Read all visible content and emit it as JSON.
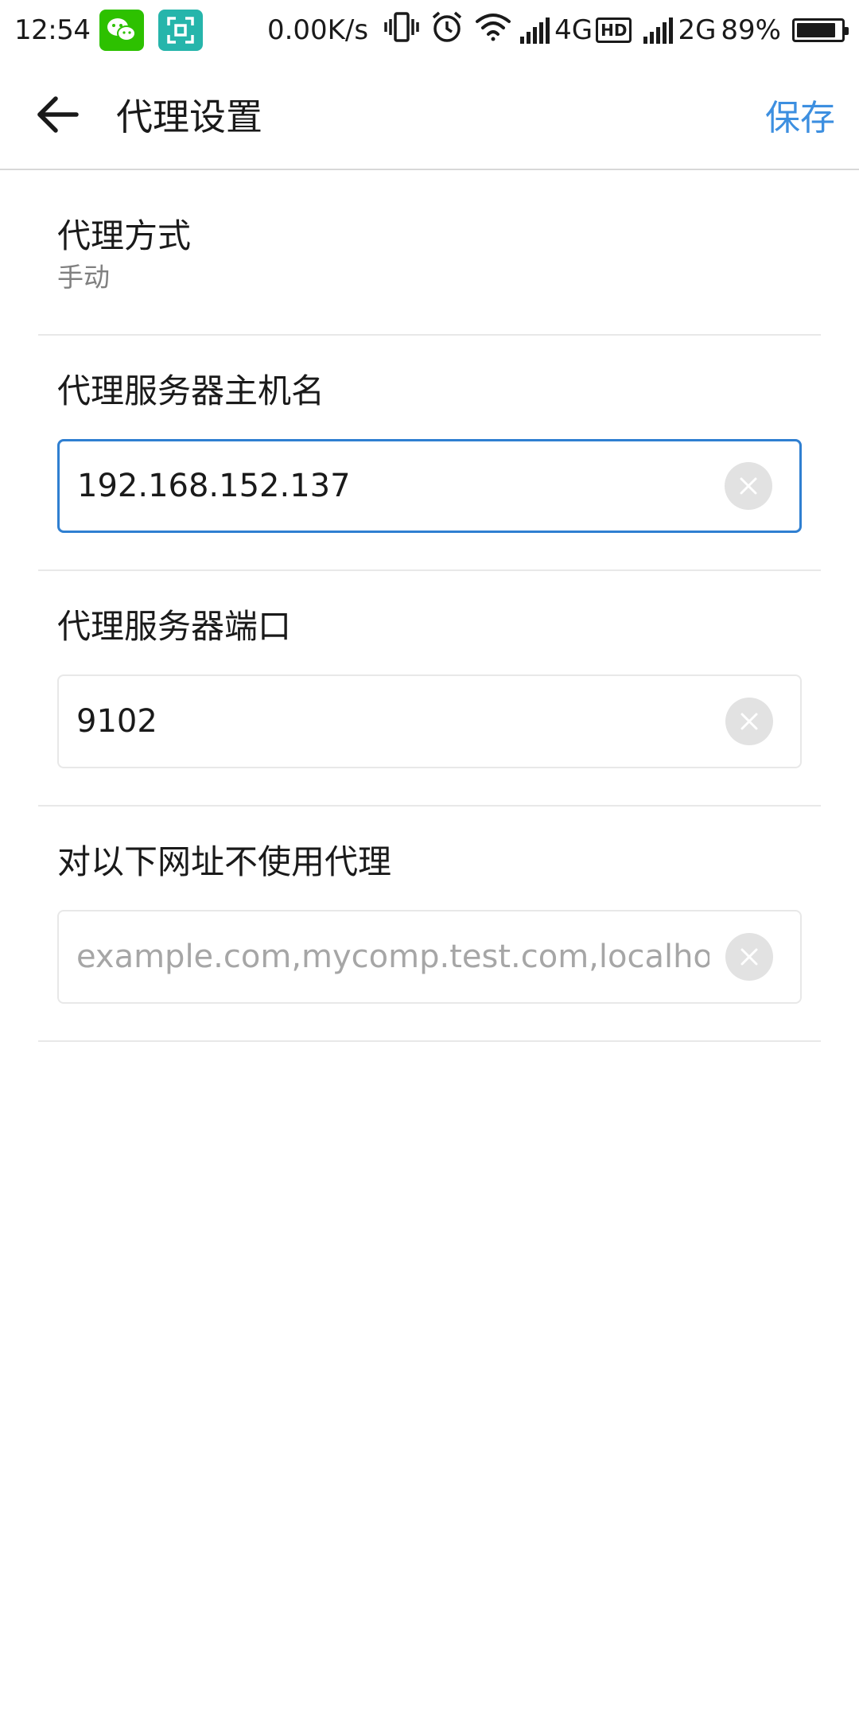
{
  "status_bar": {
    "time": "12:54",
    "net_speed": "0.00K/s",
    "sim1_type": "4G",
    "hd_label": "HD",
    "sim2_type": "2G",
    "battery_percent": "89%",
    "battery_level": 0.89,
    "icons": [
      "wechat-icon",
      "scan-icon",
      "vibrate-icon",
      "alarm-icon",
      "wifi-icon",
      "signal-icon",
      "signal-icon",
      "battery-icon"
    ]
  },
  "app_bar": {
    "title": "代理设置",
    "save_label": "保存",
    "back_icon": "arrow-left-icon"
  },
  "proxy_mode": {
    "title": "代理方式",
    "value": "手动"
  },
  "fields": {
    "hostname": {
      "label": "代理服务器主机名",
      "value": "192.168.152.137"
    },
    "port": {
      "label": "代理服务器端口",
      "value": "9102"
    },
    "bypass": {
      "label": "对以下网址不使用代理",
      "value": "",
      "placeholder": "example.com,mycomp.test.com,localhost"
    }
  },
  "colors": {
    "accent": "#3d8fe0",
    "focus_border": "#2f7fd1",
    "secondary_text": "#808080",
    "placeholder_text": "#a6a6a6"
  }
}
